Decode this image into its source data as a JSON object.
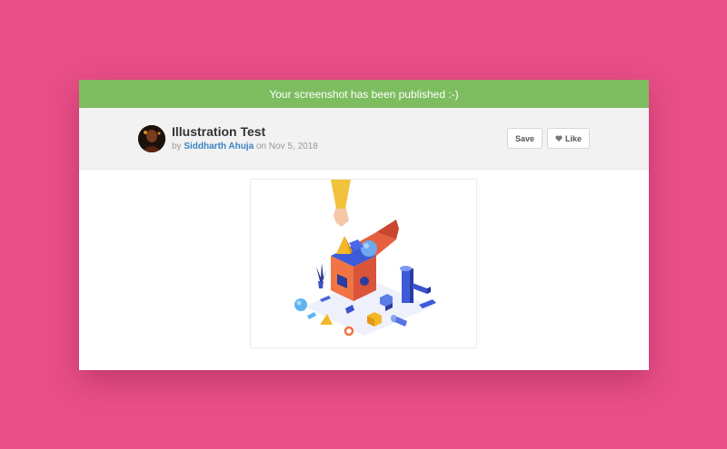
{
  "banner": {
    "message": "Your screenshot has been published :-)"
  },
  "shot": {
    "title": "Illustration Test",
    "by_label": "by",
    "author": "Siddharth Ahuja",
    "on_label": "on",
    "date": "Nov 5, 2018"
  },
  "actions": {
    "save_label": "Save",
    "like_label": "Like"
  },
  "icons": {
    "like": "heart-icon"
  },
  "colors": {
    "background": "#e94e87",
    "banner": "#7dbd60",
    "author_link": "#3b84c4"
  }
}
